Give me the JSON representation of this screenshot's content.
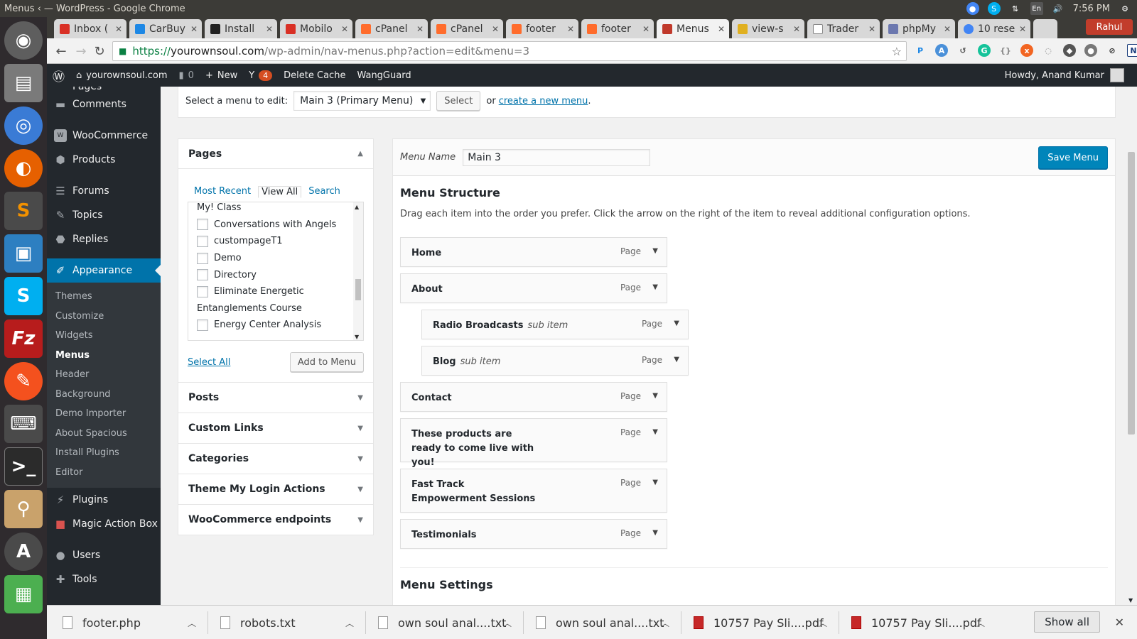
{
  "os": {
    "window_title": "Menus ‹ — WordPress - Google Chrome",
    "time": "7:56 PM",
    "user": "Rahul",
    "lang": "En"
  },
  "tabs": [
    {
      "label": "Inbox (",
      "color": "#d93025"
    },
    {
      "label": "CarBuy",
      "color": "#1e88e5"
    },
    {
      "label": "Install",
      "color": "#222222"
    },
    {
      "label": "Mobilo",
      "color": "#d93025"
    },
    {
      "label": "cPanel",
      "color": "#ff6c2c"
    },
    {
      "label": "cPanel",
      "color": "#ff6c2c"
    },
    {
      "label": "footer",
      "color": "#ff6c2c"
    },
    {
      "label": "footer",
      "color": "#ff6c2c"
    },
    {
      "label": "Menus",
      "color": "#c0392b"
    },
    {
      "label": "view-s",
      "color": "#e0b020"
    },
    {
      "label": "Trader",
      "color": "#888888"
    },
    {
      "label": "phpMy",
      "color": "#6c78af"
    },
    {
      "label": "10 rese",
      "color": "#4285f4"
    }
  ],
  "browser": {
    "url_scheme": "https://",
    "url_host": "yourownsoul.com",
    "url_path": "/wp-admin/nav-menus.php?action=edit&menu=3"
  },
  "adminbar": {
    "site": "yourownsoul.com",
    "comments": "0",
    "new": "New",
    "yoast_count": "4",
    "delete_cache": "Delete Cache",
    "wangguard": "WangGuard",
    "howdy": "Howdy, Anand Kumar"
  },
  "sidebar": {
    "top": [
      {
        "label": "Pages",
        "name": "sidebar-item-pages"
      },
      {
        "label": "Comments",
        "name": "sidebar-item-comments"
      },
      {
        "label": "WooCommerce",
        "name": "sidebar-item-woocommerce"
      },
      {
        "label": "Products",
        "name": "sidebar-item-products"
      },
      {
        "label": "Forums",
        "name": "sidebar-item-forums"
      },
      {
        "label": "Topics",
        "name": "sidebar-item-topics"
      },
      {
        "label": "Replies",
        "name": "sidebar-item-replies"
      }
    ],
    "appearance": "Appearance",
    "sub": [
      "Themes",
      "Customize",
      "Widgets",
      "Menus",
      "Header",
      "Background",
      "Demo Importer",
      "About Spacious",
      "Install Plugins",
      "Editor"
    ],
    "bottom": [
      {
        "label": "Plugins",
        "name": "sidebar-item-plugins"
      },
      {
        "label": "Magic Action Box",
        "name": "sidebar-item-magic-action-box"
      },
      {
        "label": "Users",
        "name": "sidebar-item-users"
      },
      {
        "label": "Tools",
        "name": "sidebar-item-tools"
      }
    ]
  },
  "manage": {
    "label": "Select a menu to edit:",
    "selected": "Main 3 (Primary Menu)",
    "select_btn": "Select",
    "or": "or",
    "create_link": "create a new menu",
    "period": "."
  },
  "pages_panel": {
    "title": "Pages",
    "tabs": [
      "Most Recent",
      "View All",
      "Search"
    ],
    "items": [
      {
        "label": "My! Class",
        "checkbox": false
      },
      {
        "label": "Conversations with Angels",
        "checkbox": true
      },
      {
        "label": "custompageT1",
        "checkbox": true
      },
      {
        "label": "Demo",
        "checkbox": true
      },
      {
        "label": "Directory",
        "checkbox": true
      },
      {
        "label": "Eliminate Energetic",
        "checkbox": true
      },
      {
        "label": "Entanglements Course",
        "checkbox": false
      },
      {
        "label": "Energy Center Analysis",
        "checkbox": true
      }
    ],
    "select_all": "Select All",
    "add_btn": "Add to Menu"
  },
  "accordions": [
    "Posts",
    "Custom Links",
    "Categories",
    "Theme My Login Actions",
    "WooCommerce endpoints"
  ],
  "menu": {
    "name_label": "Menu Name",
    "name_value": "Main 3",
    "save": "Save Menu",
    "structure_title": "Menu Structure",
    "instructions": "Drag each item into the order you prefer. Click the arrow on the right of the item to reveal additional configuration options.",
    "items": [
      {
        "title": "Home",
        "sub": "",
        "type": "Page",
        "depth": 0
      },
      {
        "title": "About",
        "sub": "",
        "type": "Page",
        "depth": 0
      },
      {
        "title": "Radio Broadcasts",
        "sub": "sub item",
        "type": "Page",
        "depth": 1
      },
      {
        "title": "Blog",
        "sub": "sub item",
        "type": "Page",
        "depth": 1
      },
      {
        "title": "Contact",
        "sub": "",
        "type": "Page",
        "depth": 0
      },
      {
        "title": "These products are ready to come live with you!",
        "sub": "",
        "type": "Page",
        "depth": 0
      },
      {
        "title": "Fast Track Empowerment Sessions",
        "sub": "",
        "type": "Page",
        "depth": 0
      },
      {
        "title": "Testimonials",
        "sub": "",
        "type": "Page",
        "depth": 0
      }
    ],
    "settings_title": "Menu Settings"
  },
  "downloads": {
    "files": [
      "footer.php",
      "robots.txt",
      "own soul anal....txt",
      "own soul anal....txt",
      "10757 Pay Sli....pdf",
      "10757 Pay Sli....pdf"
    ],
    "show_all": "Show all"
  }
}
